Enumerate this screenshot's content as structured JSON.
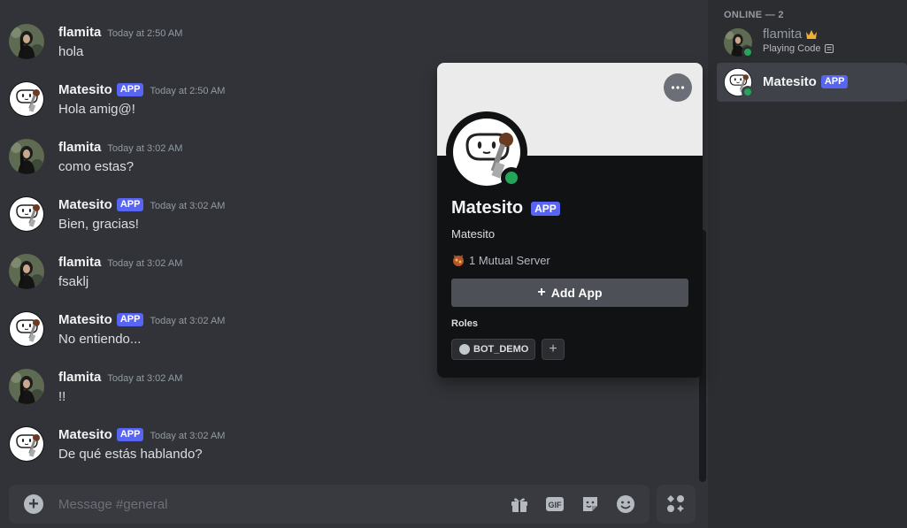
{
  "messages": [
    {
      "author": "flamita",
      "avatar": "flamita-avatar",
      "is_app": false,
      "time": "Today at 2:50 AM",
      "text": "hola"
    },
    {
      "author": "Matesito",
      "avatar": "matesito-avatar",
      "is_app": true,
      "time": "Today at 2:50 AM",
      "text": "Hola amig@!"
    },
    {
      "author": "flamita",
      "avatar": "flamita-avatar",
      "is_app": false,
      "time": "Today at 3:02 AM",
      "text": "como estas?"
    },
    {
      "author": "Matesito",
      "avatar": "matesito-avatar",
      "is_app": true,
      "time": "Today at 3:02 AM",
      "text": "Bien, gracias!"
    },
    {
      "author": "flamita",
      "avatar": "flamita-avatar",
      "is_app": false,
      "time": "Today at 3:02 AM",
      "text": "fsaklj"
    },
    {
      "author": "Matesito",
      "avatar": "matesito-avatar",
      "is_app": true,
      "time": "Today at 3:02 AM",
      "text": "No entiendo..."
    },
    {
      "author": "flamita",
      "avatar": "flamita-avatar",
      "is_app": false,
      "time": "Today at 3:02 AM",
      "text": "!!"
    },
    {
      "author": "Matesito",
      "avatar": "matesito-avatar",
      "is_app": true,
      "time": "Today at 3:02 AM",
      "text": "De qué estás hablando?"
    }
  ],
  "app_badge": "APP",
  "composer": {
    "placeholder": "Message #general",
    "icons": [
      "gift-icon",
      "gif-icon",
      "sticker-icon",
      "emoji-icon",
      "apps-icon"
    ]
  },
  "members": {
    "heading": "ONLINE — 2",
    "list": [
      {
        "name": "flamita",
        "activity": "Playing Code",
        "owner_crown": true,
        "status": "online"
      },
      {
        "name": "Matesito",
        "is_app": true,
        "status": "online"
      }
    ]
  },
  "profile": {
    "display_name": "Matesito",
    "username": "Matesito",
    "mutual": "1 Mutual Server",
    "add_app": "Add App",
    "roles_heading": "Roles",
    "roles": [
      "BOT_DEMO"
    ]
  },
  "colors": {
    "accent": "#5865f2",
    "online": "#23a55a",
    "chat_bg": "#313338",
    "sidebar_bg": "#2b2d31",
    "popout_bg": "#111214",
    "banner": "#ebebeb"
  }
}
